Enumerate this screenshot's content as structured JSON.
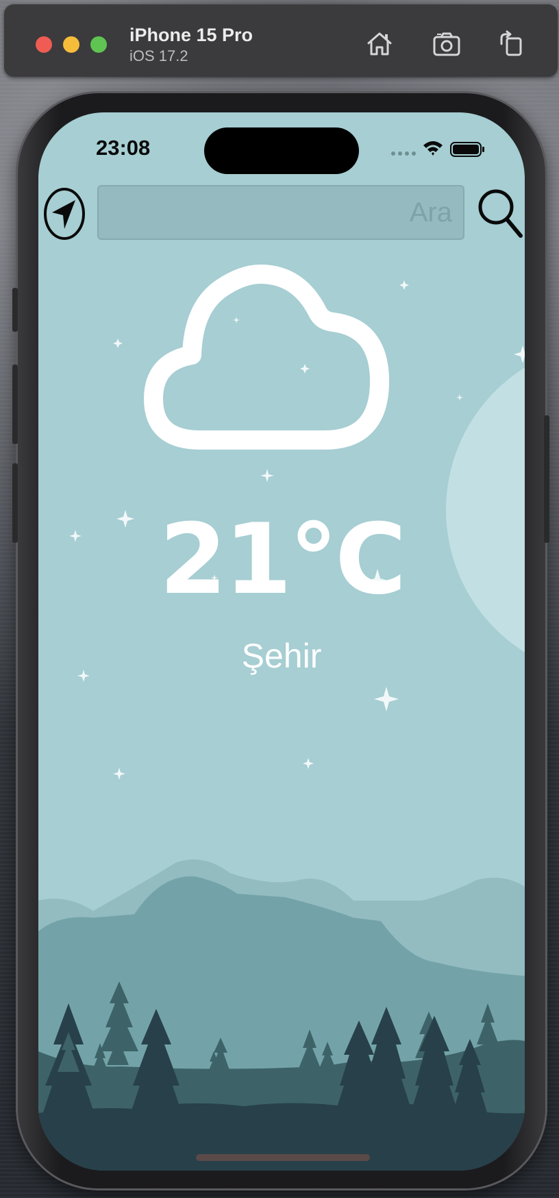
{
  "simulator": {
    "device_name": "iPhone 15 Pro",
    "os_version": "iOS 17.2",
    "toolbar_icons": [
      "home-icon",
      "screenshot-icon",
      "rotate-icon"
    ]
  },
  "status_bar": {
    "time": "23:08",
    "icons": [
      "cellular-signal-icon",
      "wifi-icon",
      "battery-icon"
    ]
  },
  "search": {
    "value": "",
    "placeholder": "Ara"
  },
  "weather": {
    "icon": "cloud-icon",
    "temperature": "21°C",
    "city": "Şehir"
  },
  "colors": {
    "sky": "#a6ced3",
    "mountain_light": "#93bcc1",
    "mountain_mid": "#73a3a8",
    "hill_dark": "#3d6368",
    "ground": "#28404a",
    "text": "#ffffff"
  }
}
